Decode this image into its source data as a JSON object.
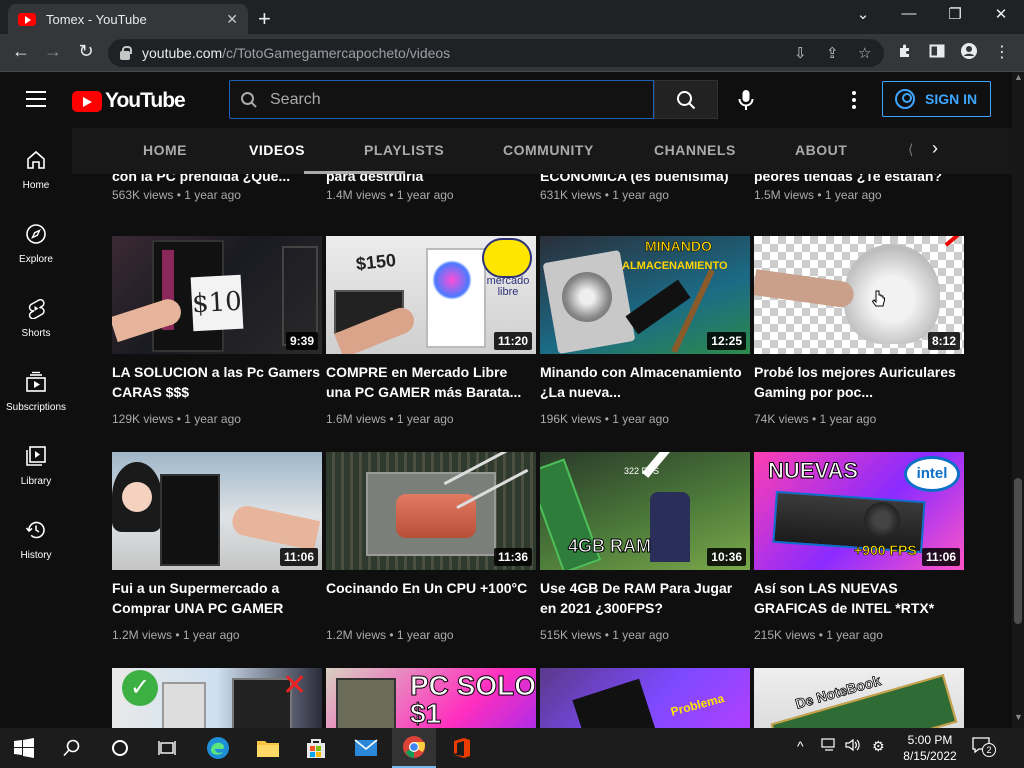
{
  "browser": {
    "tab_title": "Tomex - YouTube",
    "url_host": "youtube.com",
    "url_path": "/c/TotoGamegamercapocheto/videos"
  },
  "youtube": {
    "logo_text": "YouTube",
    "search_placeholder": "Search",
    "sign_in_label": "SIGN IN",
    "guide": [
      {
        "label": "Home",
        "icon": "home-icon"
      },
      {
        "label": "Explore",
        "icon": "compass-icon"
      },
      {
        "label": "Shorts",
        "icon": "shorts-icon"
      },
      {
        "label": "Subscriptions",
        "icon": "subscriptions-icon"
      },
      {
        "label": "Library",
        "icon": "library-icon"
      },
      {
        "label": "History",
        "icon": "history-icon"
      }
    ],
    "channel_tabs": [
      "HOME",
      "VIDEOS",
      "PLAYLISTS",
      "COMMUNITY",
      "CHANNELS",
      "ABOUT"
    ],
    "active_tab": "VIDEOS",
    "videos_row0": [
      {
        "title_tail": "con la PC prendida ¿Que...",
        "meta": "563K views • 1 year ago"
      },
      {
        "title_tail": "para destruirla",
        "meta": "1.4M views • 1 year ago"
      },
      {
        "title_tail": "ECONOMICA (es buenisima)",
        "meta": "631K views • 1 year ago"
      },
      {
        "title_tail": "peores tiendas ¿Te estafan?",
        "meta": "1.5M views • 1 year ago"
      }
    ],
    "videos_row1": [
      {
        "title": "LA SOLUCION a las Pc Gamers CARAS $$$",
        "meta": "129K views • 1 year ago",
        "duration": "9:39",
        "thumb_text": "$10"
      },
      {
        "title": "COMPRE en Mercado Libre una PC GAMER más Barata...",
        "meta": "1.6M views • 1 year ago",
        "duration": "11:20",
        "thumb_text": "$150",
        "thumb_text2": "mercado libre"
      },
      {
        "title": "Minando con Almacenamiento ¿La nueva...",
        "meta": "196K views • 1 year ago",
        "duration": "12:25",
        "thumb_text": "MINANDO",
        "thumb_text2": "ALMACENAMIENTO"
      },
      {
        "title": "Probé los mejores Auriculares Gaming por poc...",
        "meta": "74K views • 1 year ago",
        "duration": "8:12"
      }
    ],
    "videos_row2": [
      {
        "title": "Fui a un Supermercado a Comprar UNA PC GAMER",
        "meta": "1.2M views • 1 year ago",
        "duration": "11:06"
      },
      {
        "title": "Cocinando En Un CPU +100°C",
        "meta": "1.2M views • 1 year ago",
        "duration": "11:36"
      },
      {
        "title": "Use 4GB De RAM Para Jugar en 2021 ¿300FPS?",
        "meta": "515K views • 1 year ago",
        "duration": "10:36",
        "thumb_text": "4GB RAM"
      },
      {
        "title": "Así son LAS NUEVAS GRAFICAS de INTEL *RTX*",
        "meta": "215K views • 1 year ago",
        "duration": "11:06",
        "thumb_text": "NUEVAS",
        "thumb_text2": "+900 FPS",
        "thumb_text3": "intel"
      }
    ],
    "videos_row3": [
      {
        "thumb_text": ""
      },
      {
        "thumb_text": "PC SOLO $1"
      },
      {
        "thumb_text": "Problema"
      },
      {
        "thumb_text": "De NoteBook"
      }
    ]
  },
  "taskbar": {
    "time": "5:00 PM",
    "date": "8/15/2022",
    "notifications": "2"
  }
}
